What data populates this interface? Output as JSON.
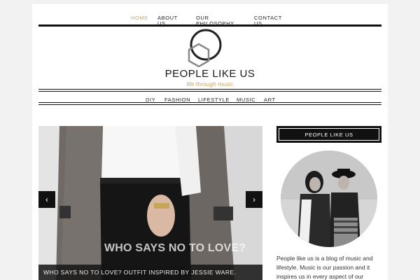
{
  "topnav": {
    "items": [
      {
        "label": "HOME",
        "active": true
      },
      {
        "label": "ABOUT\nUS"
      },
      {
        "label": "OUR\nPHILOSOPHY"
      },
      {
        "label": "CONTACT\nUS"
      }
    ]
  },
  "header": {
    "title": "PEOPLE LIKE US",
    "tagline": "life through music"
  },
  "categories": [
    "DIY",
    "FASHION",
    "LIFESTYLE",
    "MUSIC",
    "ART"
  ],
  "slider": {
    "overlay_title": "WHO SAYS NO TO LOVE?",
    "caption": "WHO SAYS NO TO LOVE? OUTFIT INSPIRED BY JESSIE WARE.",
    "prev_icon": "chevron-left-icon",
    "next_icon": "chevron-right-icon",
    "prev_glyph": "‹",
    "next_glyph": "›"
  },
  "sidebar": {
    "widget_title": "PEOPLE LIKE US",
    "about_text": "People like us is a blog of music and lifestyle. Music is our passion and it inspires us in every aspect of our"
  },
  "colors": {
    "accent": "#c9a45d",
    "dark": "#111111",
    "background": "#f2f2f2"
  }
}
